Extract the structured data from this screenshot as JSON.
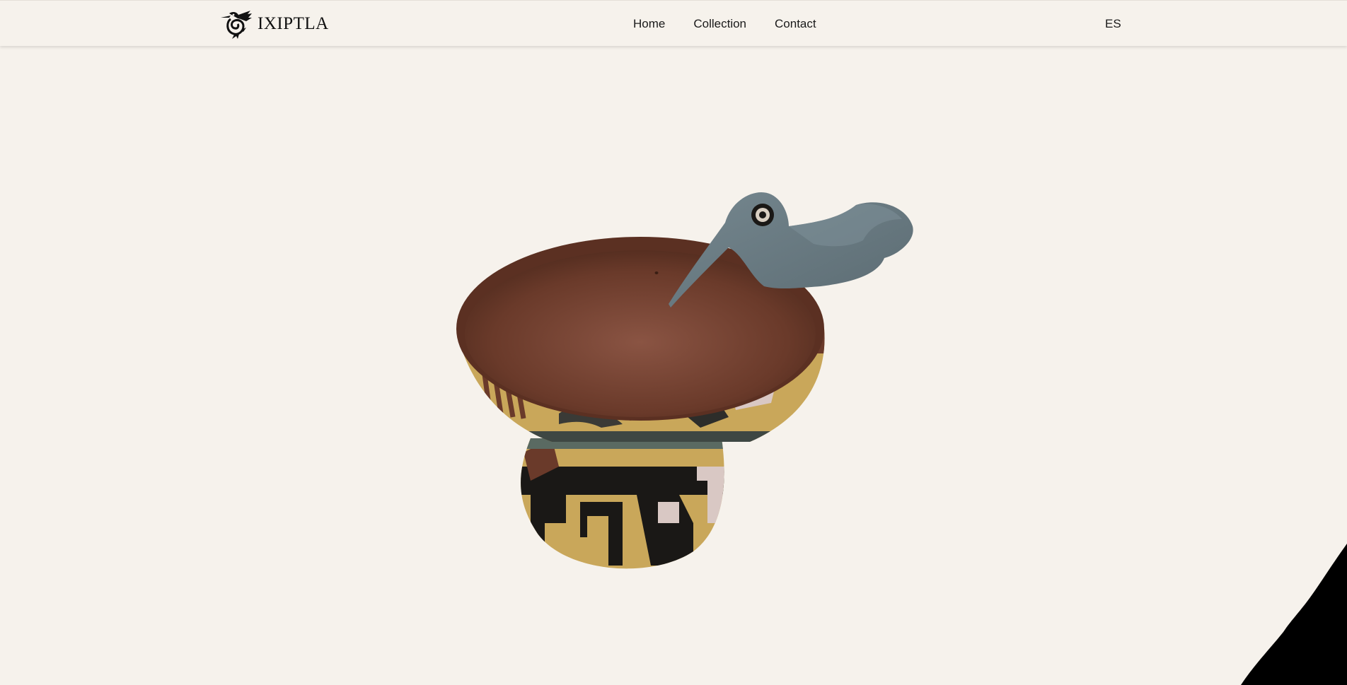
{
  "header": {
    "brand_name": "IXIPTLA",
    "logo_icon": "hummingbird-logo-icon",
    "nav": [
      {
        "label": "Home"
      },
      {
        "label": "Collection"
      },
      {
        "label": "Contact"
      }
    ],
    "language": "ES"
  },
  "main": {
    "artwork_icon": "hummingbird-bowl-illustration"
  },
  "colors": {
    "background": "#f6f2ec",
    "bowl_interior": "#6a3a2a",
    "bird": "#6e7f87",
    "ochre": "#c9a75a",
    "black": "#111111"
  }
}
